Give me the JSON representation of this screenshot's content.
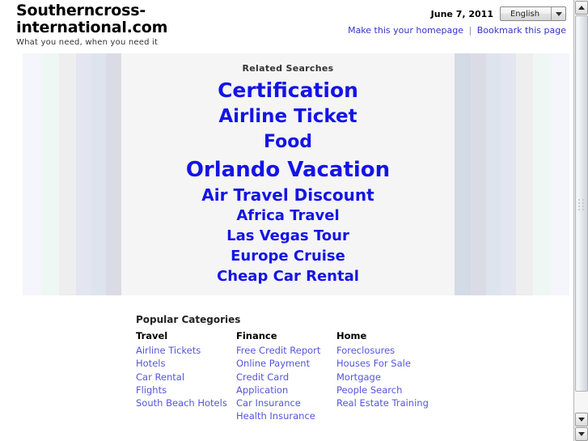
{
  "header": {
    "brand_line1": "Southerncross-",
    "brand_line2": "international.com",
    "tagline": "What you need, when you need it",
    "date": "June 7, 2011",
    "language": {
      "selected": "English",
      "caret_icon": "chevron-down-icon"
    },
    "links": {
      "homepage": "Make this your homepage",
      "separator": "|",
      "bookmark": "Bookmark this page"
    }
  },
  "related": {
    "heading": "Related Searches",
    "items": [
      {
        "label": "Certification",
        "size": 25
      },
      {
        "label": "Airline Ticket",
        "size": 23
      },
      {
        "label": "Food",
        "size": 22
      },
      {
        "label": "Orlando Vacation",
        "size": 26
      },
      {
        "label": "Air Travel Discount",
        "size": 20
      },
      {
        "label": "Africa Travel",
        "size": 18
      },
      {
        "label": "Las Vegas Tour",
        "size": 18
      },
      {
        "label": "Europe Cruise",
        "size": 18
      },
      {
        "label": "Cheap Car Rental",
        "size": 18
      }
    ]
  },
  "popular": {
    "heading": "Popular Categories",
    "columns": [
      {
        "title": "Travel",
        "links": [
          "Airline Tickets",
          "Hotels",
          "Car Rental",
          "Flights",
          "South Beach Hotels"
        ]
      },
      {
        "title": "Finance",
        "links": [
          "Free Credit Report",
          "Online Payment",
          "Credit Card",
          "Application",
          "Car Insurance",
          "Health Insurance"
        ]
      },
      {
        "title": "Home",
        "links": [
          "Foreclosures",
          "Houses For Sale",
          "Mortgage",
          "People Search",
          "Real Estate Training"
        ]
      }
    ]
  },
  "background": {
    "center_panel_color": "#f5f5f5",
    "stripes_left": [
      {
        "color": "#f5f6fc",
        "width": 23
      },
      {
        "color": "#eff7f5",
        "width": 22
      },
      {
        "color": "#eeeeee",
        "width": 21
      },
      {
        "color": "#e3e5f0",
        "width": 19
      },
      {
        "color": "#dde4ee",
        "width": 18
      },
      {
        "color": "#dbdbe6",
        "width": 19
      },
      {
        "color": "#d2dbe6",
        "width": 20
      }
    ],
    "stripes_right": [
      {
        "color": "#d2dbe6",
        "width": 20
      },
      {
        "color": "#dbdbe6",
        "width": 19
      },
      {
        "color": "#dde4ee",
        "width": 18
      },
      {
        "color": "#e3e5f0",
        "width": 19
      },
      {
        "color": "#eeeeee",
        "width": 21
      },
      {
        "color": "#eff7f5",
        "width": 22
      },
      {
        "color": "#f5f6fc",
        "width": 23
      }
    ]
  },
  "scrollbar": {
    "up_icon": "scroll-up-arrow-icon",
    "down_icon_1": "scroll-down-arrow-icon",
    "down_icon_2": "scroll-down-arrow-icon",
    "thumb_icon": "scrollbar-thumb-grip"
  },
  "colors": {
    "related_link": "#1414e6",
    "category_link": "#5555dd",
    "header_link": "#3333cc"
  }
}
